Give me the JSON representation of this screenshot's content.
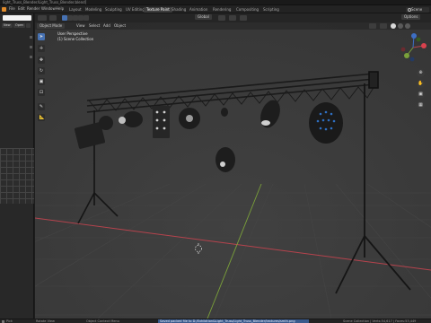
{
  "window": {
    "title": "light_Truss_Blender/Light_Truss_Blender.blend]"
  },
  "menubar": {
    "menus": [
      "File",
      "Edit",
      "Render",
      "Window",
      "Help"
    ],
    "workspace_tabs": [
      "Layout",
      "Modeling",
      "Sculpting",
      "UV Editing",
      "Texture Paint",
      "Shading",
      "Animation",
      "Rendering",
      "Compositing",
      "Scripting"
    ],
    "active_tab": "Texture Paint",
    "scene_label": "Scene"
  },
  "left_panel": {
    "new_label": "New",
    "open_label": "Open"
  },
  "viewport": {
    "object_mode": "Object Mode",
    "menus": [
      "View",
      "Select",
      "Add",
      "Object"
    ],
    "transform_orientation": "Global",
    "options_label": "Options",
    "view_name": "User Perspective",
    "collection_name": "(1) Scene Collection"
  },
  "status": {
    "left": "Pick",
    "select_label": "Rotate View",
    "context_menu": "Object Context Menu",
    "message": "Saved packed file to D:/Exhibition&Light_Truss/Light_Truss_Blender/textures/smth.png",
    "right": "Scene Collection | Verts:54,617 | Faces:53,449"
  },
  "colors": {
    "accent": "#4772b3",
    "grid_bg": "#3a3a3a",
    "x_axis": "#b6434d",
    "y_axis": "#7aa03a",
    "status_bar": "#3a5a8c"
  }
}
